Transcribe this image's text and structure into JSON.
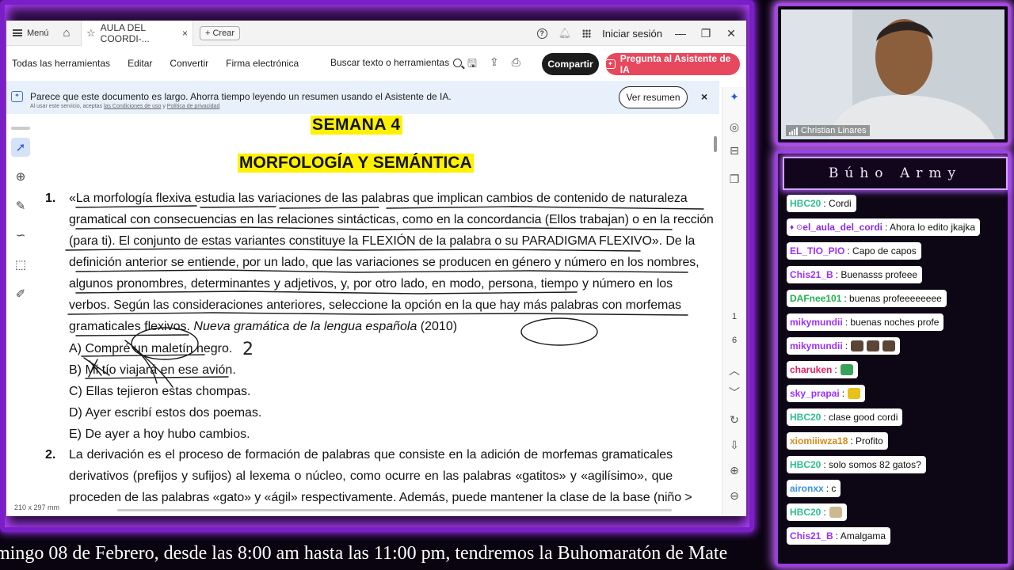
{
  "tabbar": {
    "menu_label": "Menú",
    "tab_title": "AULA DEL COORDI-...",
    "create_label": "Crear",
    "signin_label": "Iniciar sesión"
  },
  "toolbar": {
    "items": [
      "Todas las herramientas",
      "Editar",
      "Convertir",
      "Firma electrónica"
    ],
    "search_label": "Buscar texto o herramientas",
    "share_label": "Compartir",
    "ai_label": "Pregunta al Asistente de IA"
  },
  "banner": {
    "message": "Parece que este documento es largo. Ahorra tiempo leyendo un resumen usando el Asistente de IA.",
    "sub_prefix": "Al usar este servicio, aceptas",
    "sub_link1": "las Condiciones de uso",
    "sub_mid": "y",
    "sub_link2": "Política de privacidad",
    "button": "Ver resumen",
    "close": "×"
  },
  "document": {
    "title1": "SEMANA 4",
    "title2": "MORFOLOGÍA Y SEMÁNTICA",
    "q1_num": "1.",
    "q1_lines": [
      "«La morfología flexiva estudia las variaciones de las palabras que implican cambios de contenido de naturaleza",
      "gramatical con consecuencias en las relaciones sintácticas, como en la concordancia (Ellos trabajan) o en la rección",
      "(para ti). El conjunto de estas variantes constituye la FLEXIÓN de la palabra o su PARADIGMA FLEXIVO». De la",
      "definición anterior se entiende, por un lado, que las variaciones se producen en género y número en los nombres,",
      "algunos pronombres, determinantes y adjetivos, y, por otro lado, en modo, persona, tiempo y número en los",
      "verbos. Según las consideraciones anteriores, seleccione la opción en la que hay más palabras con morfemas"
    ],
    "q1_last_plain": "gramaticales flexivos. ",
    "q1_last_italic": "Nueva gramática de la lengua española",
    "q1_last_year": " (2010)",
    "options": [
      "A) Compré un maletín negro.",
      "B) Mi tío viajará en ese avión.",
      "C) Ellas tejieron estas chompas.",
      "D) Ayer escribí estos dos poemas.",
      "E) De ayer a hoy hubo cambios."
    ],
    "q2_num": "2.",
    "q2_lines": [
      "La derivación es el proceso de formación de palabras que consiste en la adición de morfemas gramaticales",
      "derivativos (prefijos y sufijos) al lexema o núcleo, como ocurre en las palabras «gatitos» y «agilísimo», que",
      "proceden de las palabras «gato» y «ágil» respectivamente. Además, puede mantener la clase de la base (niño >"
    ],
    "handwritten_mark": "2",
    "page_size": "210 x 297 mm",
    "page_current": "1",
    "page_total": "6"
  },
  "camera": {
    "name": "Christian Linares"
  },
  "chat": {
    "title": "Búho Army",
    "messages": [
      {
        "user": "HBC20",
        "text": ": Cordi",
        "color": "#2fbf8f"
      },
      {
        "user": "el_aula_del_cordi",
        "text": ": Ahora lo edito jkajka",
        "color": "#8a2be2"
      },
      {
        "user": "EL_TIO_PIO",
        "text": ": Capo de capos",
        "color": "#9b30ff"
      },
      {
        "user": "Chis21_B",
        "text": ": Buenasss profeee",
        "color": "#9b30ff"
      },
      {
        "user": "DAFnee101",
        "text": ": buenas profeeeeeeee",
        "color": "#22b14c"
      },
      {
        "user": "mikymundii",
        "text": ": buenas noches profe",
        "color": "#9b30ff"
      },
      {
        "user": "mikymundii",
        "text": ": ",
        "color": "#9b30ff"
      },
      {
        "user": "charuken",
        "text": ": ",
        "color": "#e0245e"
      },
      {
        "user": "sky_prapai",
        "text": ": ",
        "color": "#9b30ff"
      },
      {
        "user": "HBC20",
        "text": ": clase good cordi",
        "color": "#2fbf8f"
      },
      {
        "user": "xiomiiiwza18",
        "text": ": Profito",
        "color": "#d48a1a"
      },
      {
        "user": "HBC20",
        "text": ": solo somos 82 gatos?",
        "color": "#2fbf8f"
      },
      {
        "user": "aironxx",
        "text": ": c",
        "color": "#3a8fe0"
      },
      {
        "user": "HBC20",
        "text": ": ",
        "color": "#2fbf8f"
      },
      {
        "user": "Chis21_B",
        "text": ": Amalgama",
        "color": "#9b30ff"
      }
    ]
  },
  "ticker": "mingo 08 de Febrero, desde las 8:00 am hasta las 11:00 pm, tendremos la Buhomaratón de Mate",
  "colors": {
    "frame": "#7a1fc8",
    "highlight": "#fff200",
    "ai_button": "#e8485d"
  }
}
